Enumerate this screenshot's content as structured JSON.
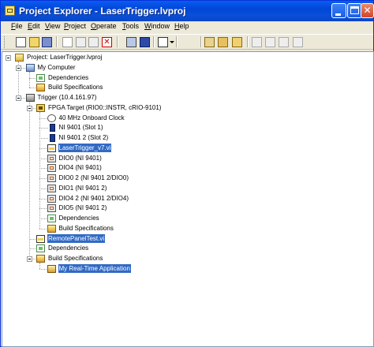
{
  "window": {
    "title": "Project Explorer - LaserTrigger.lvproj"
  },
  "menu": [
    {
      "hot": "F",
      "rest": "ile"
    },
    {
      "hot": "E",
      "rest": "dit"
    },
    {
      "hot": "V",
      "rest": "iew"
    },
    {
      "hot": "P",
      "rest": "roject"
    },
    {
      "hot": "O",
      "rest": "perate"
    },
    {
      "hot": "T",
      "rest": "ools"
    },
    {
      "hot": "W",
      "rest": "indow"
    },
    {
      "hot": "H",
      "rest": "elp"
    }
  ],
  "toolbar": {
    "icons": [
      "new-icon",
      "open-icon",
      "save-all-icon",
      "cut-icon",
      "copy-icon",
      "paste-icon",
      "delete-icon",
      "build-icon",
      "deploy-icon",
      "view-dropdown-icon",
      "add-files-icon",
      "add-folder-icon",
      "remove-icon",
      "undo-icon",
      "redo-icon",
      "help-icon"
    ]
  },
  "tree": [
    {
      "label": "Project: LaserTrigger.lvproj",
      "icon": "project-icon",
      "level": 0,
      "expanded": true
    },
    {
      "label": "My Computer",
      "icon": "computer-icon",
      "level": 1,
      "expanded": true
    },
    {
      "label": "Dependencies",
      "icon": "dependencies-icon",
      "level": 2
    },
    {
      "label": "Build Specifications",
      "icon": "build-specs-icon",
      "level": 2
    },
    {
      "label": "Trigger (10.4.161.97)",
      "icon": "rt-target-icon",
      "level": 1,
      "expanded": true
    },
    {
      "label": "FPGA Target (RIO0::INSTR, cRIO-9101)",
      "icon": "fpga-target-icon",
      "level": 2,
      "expanded": true
    },
    {
      "label": "40 MHz Onboard Clock",
      "icon": "clock-icon",
      "level": 3
    },
    {
      "label": "NI 9401 (Slot 1)",
      "icon": "module-icon",
      "level": 3
    },
    {
      "label": "NI 9401 2 (Slot 2)",
      "icon": "module-icon",
      "level": 3
    },
    {
      "label": "LaserTrigger_v7.vi",
      "icon": "vi-icon",
      "level": 3,
      "selected": true
    },
    {
      "label": "DIO0 (NI 9401)",
      "icon": "dio-icon",
      "level": 3
    },
    {
      "label": "DIO4 (NI 9401)",
      "icon": "dio-icon",
      "level": 3
    },
    {
      "label": "DIO0 2 (NI 9401 2/DIO0)",
      "icon": "dio-icon",
      "level": 3
    },
    {
      "label": "DIO1 (NI 9401 2)",
      "icon": "dio-icon",
      "level": 3
    },
    {
      "label": "DIO4 2 (NI 9401 2/DIO4)",
      "icon": "dio-icon",
      "level": 3
    },
    {
      "label": "DIO5 (NI 9401 2)",
      "icon": "dio-icon",
      "level": 3
    },
    {
      "label": "Dependencies",
      "icon": "dependencies-icon",
      "level": 3
    },
    {
      "label": "Build Specifications",
      "icon": "build-specs-icon",
      "level": 3
    },
    {
      "label": "RemotePanelTest.vi",
      "icon": "vi-icon",
      "level": 2,
      "selected": true
    },
    {
      "label": "Dependencies",
      "icon": "dependencies-icon",
      "level": 2
    },
    {
      "label": "Build Specifications",
      "icon": "build-specs-icon",
      "level": 2,
      "expanded": true
    },
    {
      "label": "My Real-Time Application",
      "icon": "rt-app-icon",
      "level": 3,
      "selected": true
    }
  ]
}
